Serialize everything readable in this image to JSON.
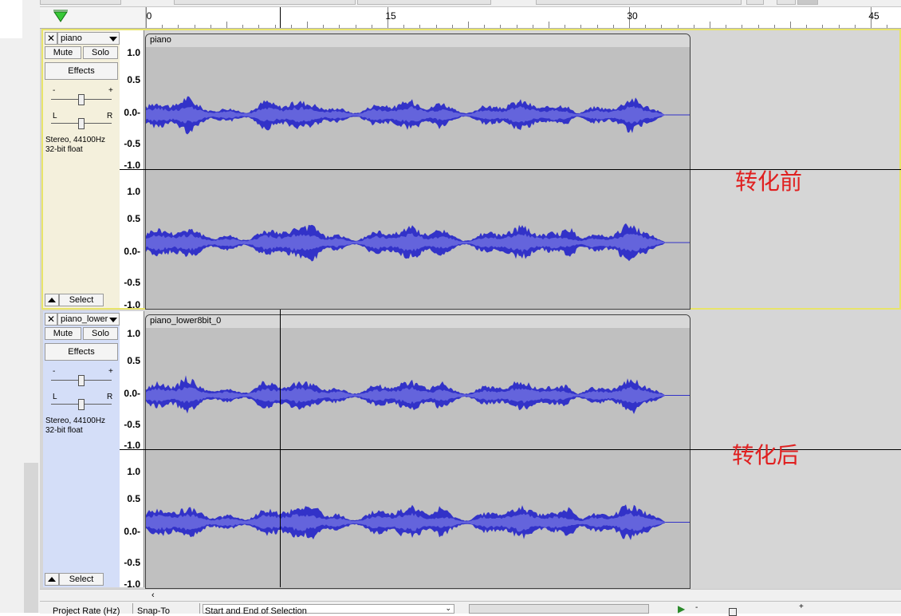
{
  "ruler": {
    "labels": [
      {
        "text": "0",
        "value": 0
      },
      {
        "text": "15",
        "value": 15
      },
      {
        "text": "30",
        "value": 30
      },
      {
        "text": "45",
        "value": 45
      }
    ],
    "play_icon": "green-triangle-icon"
  },
  "tracks": [
    {
      "id": "piano",
      "name": "piano",
      "clip_name": "piano",
      "mute_label": "Mute",
      "solo_label": "Solo",
      "effects_label": "Effects",
      "gain_minus": "-",
      "gain_plus": "+",
      "pan_left": "L",
      "pan_right": "R",
      "info_line1": "Stereo, 44100Hz",
      "info_line2": "32-bit float",
      "select_label": "Select",
      "selected": true
    },
    {
      "id": "piano_lower",
      "name": "piano_lower",
      "clip_name": "piano_lower8bit_0",
      "mute_label": "Mute",
      "solo_label": "Solo",
      "effects_label": "Effects",
      "gain_minus": "-",
      "gain_plus": "+",
      "pan_left": "L",
      "pan_right": "R",
      "info_line1": "Stereo, 44100Hz",
      "info_line2": "32-bit float",
      "select_label": "Select",
      "selected": false
    }
  ],
  "scale_labels": [
    "1.0",
    "0.5",
    "0.0-",
    "-0.5",
    "-1.0"
  ],
  "annotations": {
    "before": "转化前",
    "after": "转化后"
  },
  "selection_bar": {
    "project_rate": "Project Rate (Hz)",
    "snap_to": "Snap-To",
    "start_end": "Start and End of Selection"
  },
  "colors": {
    "waveform": "#3232c8",
    "waveform_rms": "#6464dc",
    "clip_bg": "#c0c0c0",
    "annotation": "#e02020",
    "selected_outline": "#e8e46a"
  }
}
